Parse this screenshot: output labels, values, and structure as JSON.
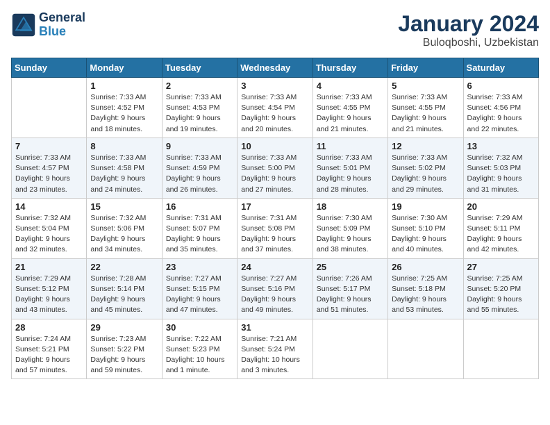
{
  "header": {
    "logo_line1": "General",
    "logo_line2": "Blue",
    "month": "January 2024",
    "location": "Buloqboshi, Uzbekistan"
  },
  "weekdays": [
    "Sunday",
    "Monday",
    "Tuesday",
    "Wednesday",
    "Thursday",
    "Friday",
    "Saturday"
  ],
  "weeks": [
    [
      {
        "day": "",
        "info": ""
      },
      {
        "day": "1",
        "info": "Sunrise: 7:33 AM\nSunset: 4:52 PM\nDaylight: 9 hours\nand 18 minutes."
      },
      {
        "day": "2",
        "info": "Sunrise: 7:33 AM\nSunset: 4:53 PM\nDaylight: 9 hours\nand 19 minutes."
      },
      {
        "day": "3",
        "info": "Sunrise: 7:33 AM\nSunset: 4:54 PM\nDaylight: 9 hours\nand 20 minutes."
      },
      {
        "day": "4",
        "info": "Sunrise: 7:33 AM\nSunset: 4:55 PM\nDaylight: 9 hours\nand 21 minutes."
      },
      {
        "day": "5",
        "info": "Sunrise: 7:33 AM\nSunset: 4:55 PM\nDaylight: 9 hours\nand 21 minutes."
      },
      {
        "day": "6",
        "info": "Sunrise: 7:33 AM\nSunset: 4:56 PM\nDaylight: 9 hours\nand 22 minutes."
      }
    ],
    [
      {
        "day": "7",
        "info": "Sunrise: 7:33 AM\nSunset: 4:57 PM\nDaylight: 9 hours\nand 23 minutes."
      },
      {
        "day": "8",
        "info": "Sunrise: 7:33 AM\nSunset: 4:58 PM\nDaylight: 9 hours\nand 24 minutes."
      },
      {
        "day": "9",
        "info": "Sunrise: 7:33 AM\nSunset: 4:59 PM\nDaylight: 9 hours\nand 26 minutes."
      },
      {
        "day": "10",
        "info": "Sunrise: 7:33 AM\nSunset: 5:00 PM\nDaylight: 9 hours\nand 27 minutes."
      },
      {
        "day": "11",
        "info": "Sunrise: 7:33 AM\nSunset: 5:01 PM\nDaylight: 9 hours\nand 28 minutes."
      },
      {
        "day": "12",
        "info": "Sunrise: 7:33 AM\nSunset: 5:02 PM\nDaylight: 9 hours\nand 29 minutes."
      },
      {
        "day": "13",
        "info": "Sunrise: 7:32 AM\nSunset: 5:03 PM\nDaylight: 9 hours\nand 31 minutes."
      }
    ],
    [
      {
        "day": "14",
        "info": "Sunrise: 7:32 AM\nSunset: 5:04 PM\nDaylight: 9 hours\nand 32 minutes."
      },
      {
        "day": "15",
        "info": "Sunrise: 7:32 AM\nSunset: 5:06 PM\nDaylight: 9 hours\nand 34 minutes."
      },
      {
        "day": "16",
        "info": "Sunrise: 7:31 AM\nSunset: 5:07 PM\nDaylight: 9 hours\nand 35 minutes."
      },
      {
        "day": "17",
        "info": "Sunrise: 7:31 AM\nSunset: 5:08 PM\nDaylight: 9 hours\nand 37 minutes."
      },
      {
        "day": "18",
        "info": "Sunrise: 7:30 AM\nSunset: 5:09 PM\nDaylight: 9 hours\nand 38 minutes."
      },
      {
        "day": "19",
        "info": "Sunrise: 7:30 AM\nSunset: 5:10 PM\nDaylight: 9 hours\nand 40 minutes."
      },
      {
        "day": "20",
        "info": "Sunrise: 7:29 AM\nSunset: 5:11 PM\nDaylight: 9 hours\nand 42 minutes."
      }
    ],
    [
      {
        "day": "21",
        "info": "Sunrise: 7:29 AM\nSunset: 5:12 PM\nDaylight: 9 hours\nand 43 minutes."
      },
      {
        "day": "22",
        "info": "Sunrise: 7:28 AM\nSunset: 5:14 PM\nDaylight: 9 hours\nand 45 minutes."
      },
      {
        "day": "23",
        "info": "Sunrise: 7:27 AM\nSunset: 5:15 PM\nDaylight: 9 hours\nand 47 minutes."
      },
      {
        "day": "24",
        "info": "Sunrise: 7:27 AM\nSunset: 5:16 PM\nDaylight: 9 hours\nand 49 minutes."
      },
      {
        "day": "25",
        "info": "Sunrise: 7:26 AM\nSunset: 5:17 PM\nDaylight: 9 hours\nand 51 minutes."
      },
      {
        "day": "26",
        "info": "Sunrise: 7:25 AM\nSunset: 5:18 PM\nDaylight: 9 hours\nand 53 minutes."
      },
      {
        "day": "27",
        "info": "Sunrise: 7:25 AM\nSunset: 5:20 PM\nDaylight: 9 hours\nand 55 minutes."
      }
    ],
    [
      {
        "day": "28",
        "info": "Sunrise: 7:24 AM\nSunset: 5:21 PM\nDaylight: 9 hours\nand 57 minutes."
      },
      {
        "day": "29",
        "info": "Sunrise: 7:23 AM\nSunset: 5:22 PM\nDaylight: 9 hours\nand 59 minutes."
      },
      {
        "day": "30",
        "info": "Sunrise: 7:22 AM\nSunset: 5:23 PM\nDaylight: 10 hours\nand 1 minute."
      },
      {
        "day": "31",
        "info": "Sunrise: 7:21 AM\nSunset: 5:24 PM\nDaylight: 10 hours\nand 3 minutes."
      },
      {
        "day": "",
        "info": ""
      },
      {
        "day": "",
        "info": ""
      },
      {
        "day": "",
        "info": ""
      }
    ]
  ]
}
